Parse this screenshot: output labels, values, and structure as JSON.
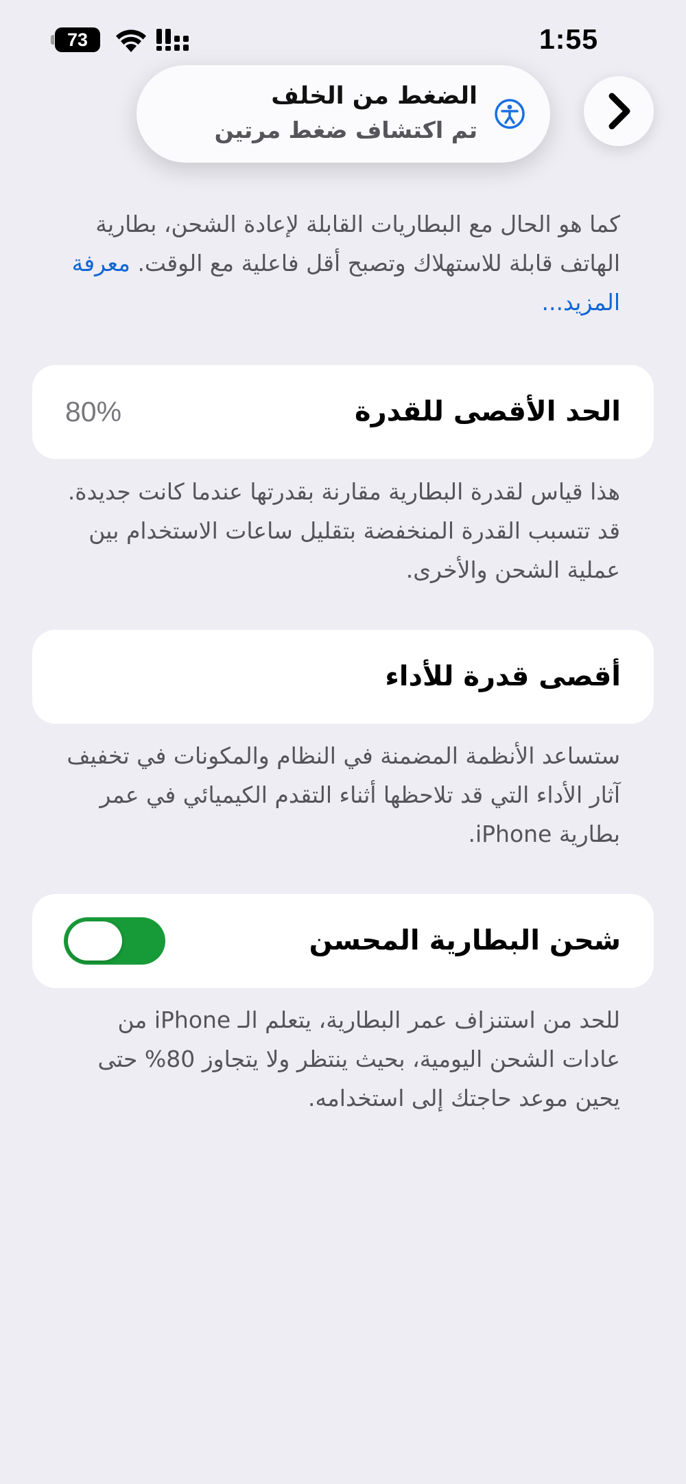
{
  "status_bar": {
    "time": "1:55",
    "battery_level": "73",
    "icons": [
      "battery-icon",
      "wifi-icon",
      "cellular-signal-icon"
    ]
  },
  "toast": {
    "title": "الضغط من الخلف",
    "subtitle": "تم اكتشاف ضغط مرتين",
    "icon": "accessibility-icon"
  },
  "nav": {
    "forward_icon": "chevron-right-icon"
  },
  "intro": {
    "text": "كما هو الحال مع البطاريات القابلة لإعادة الشحن، بطارية الهاتف قابلة للاستهلاك وتصبح أقل فاعلية مع الوقت.",
    "link": "معرفة المزيد..."
  },
  "capacity": {
    "title": "الحد الأقصى للقدرة",
    "value": "80%",
    "description": "هذا قياس لقدرة البطارية مقارنة بقدرتها عندما كانت جديدة. قد تتسبب القدرة المنخفضة بتقليل ساعات الاستخدام بين عملية الشحن والأخرى."
  },
  "performance": {
    "title": "أقصى قدرة للأداء",
    "description": "ستساعد الأنظمة المضمنة في النظام والمكونات في تخفيف آثار الأداء التي قد تلاحظها أثناء التقدم الكيميائي في عمر بطارية iPhone."
  },
  "optimized_charging": {
    "title": "شحن البطارية المحسن",
    "enabled": true,
    "description": "للحد من استنزاف عمر البطارية، يتعلم الـ iPhone من عادات الشحن اليومية، بحيث ينتظر ولا يتجاوز 80% حتى يحين موعد حاجتك إلى استخدامه."
  },
  "colors": {
    "background": "#eeedf3",
    "card": "#ffffff",
    "link": "#1166d6",
    "toggle_on": "#179a38",
    "accessibility_icon": "#1a6fe0"
  }
}
